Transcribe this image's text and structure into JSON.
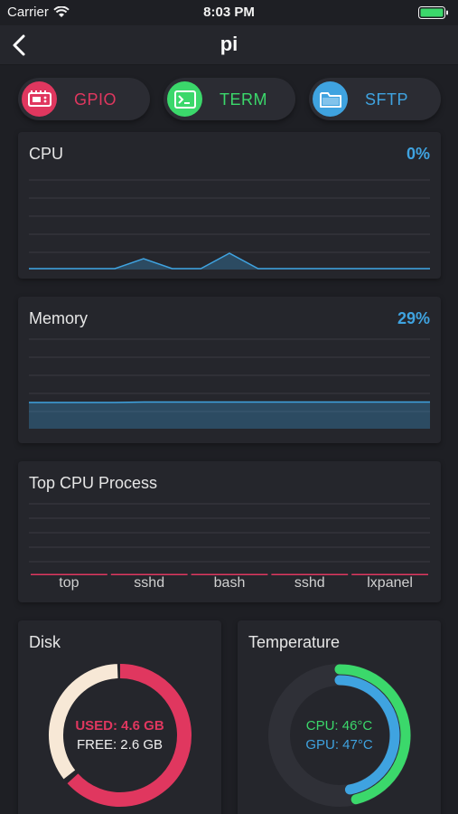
{
  "status_bar": {
    "carrier": "Carrier",
    "time": "8:03 PM"
  },
  "nav": {
    "title": "pi"
  },
  "actions": [
    {
      "label": "GPIO",
      "icon": "gpio-board-icon",
      "color": "#e0375f"
    },
    {
      "label": "TERM",
      "icon": "terminal-icon",
      "color": "#3bd86b"
    },
    {
      "label": "SFTP",
      "icon": "folder-icon",
      "color": "#3fa3e0"
    }
  ],
  "cpu": {
    "title": "CPU",
    "value": "0%",
    "chart_data": {
      "type": "area",
      "x": [
        0,
        1,
        2,
        3,
        4,
        5,
        6,
        7,
        8,
        9,
        10,
        11,
        12,
        13,
        14
      ],
      "values": [
        1,
        1,
        1,
        1,
        12,
        1,
        1,
        18,
        1,
        1,
        1,
        1,
        1,
        1,
        1
      ],
      "ylim": [
        0,
        100
      ],
      "grid": true
    }
  },
  "memory": {
    "title": "Memory",
    "value": "29%",
    "chart_data": {
      "type": "area",
      "x": [
        0,
        1,
        2,
        3,
        4,
        5,
        6,
        7,
        8,
        9,
        10,
        11,
        12,
        13,
        14
      ],
      "values": [
        29,
        29,
        29,
        29,
        29.5,
        29.5,
        29.5,
        29.5,
        29.5,
        29.5,
        29.5,
        29.5,
        29.5,
        29.5,
        29.5
      ],
      "ylim": [
        0,
        100
      ],
      "grid": true
    }
  },
  "top_process": {
    "title": "Top CPU Process",
    "chart_data": {
      "type": "bar",
      "categories": [
        "top",
        "sshd",
        "bash",
        "sshd",
        "lxpanel"
      ],
      "values": [
        1,
        0.5,
        0.5,
        0.5,
        0.5
      ],
      "grid": true
    }
  },
  "disk": {
    "title": "Disk",
    "used_text": "USED: 4.6 GB",
    "free_text": "FREE: 2.6 GB",
    "colors": {
      "used": "#e0375f",
      "free": "#f7e8d6"
    },
    "chart_data": {
      "type": "pie",
      "categories": [
        "USED",
        "FREE"
      ],
      "values": [
        4.6,
        2.6
      ]
    }
  },
  "temperature": {
    "title": "Temperature",
    "cpu_text": "CPU: 46°C",
    "gpu_text": "GPU: 47°C",
    "colors": {
      "cpu": "#3bd86b",
      "gpu": "#3fa3e0"
    },
    "chart_data": {
      "type": "pie",
      "categories": [
        "CPU",
        "GPU"
      ],
      "values": [
        46,
        47
      ]
    }
  }
}
